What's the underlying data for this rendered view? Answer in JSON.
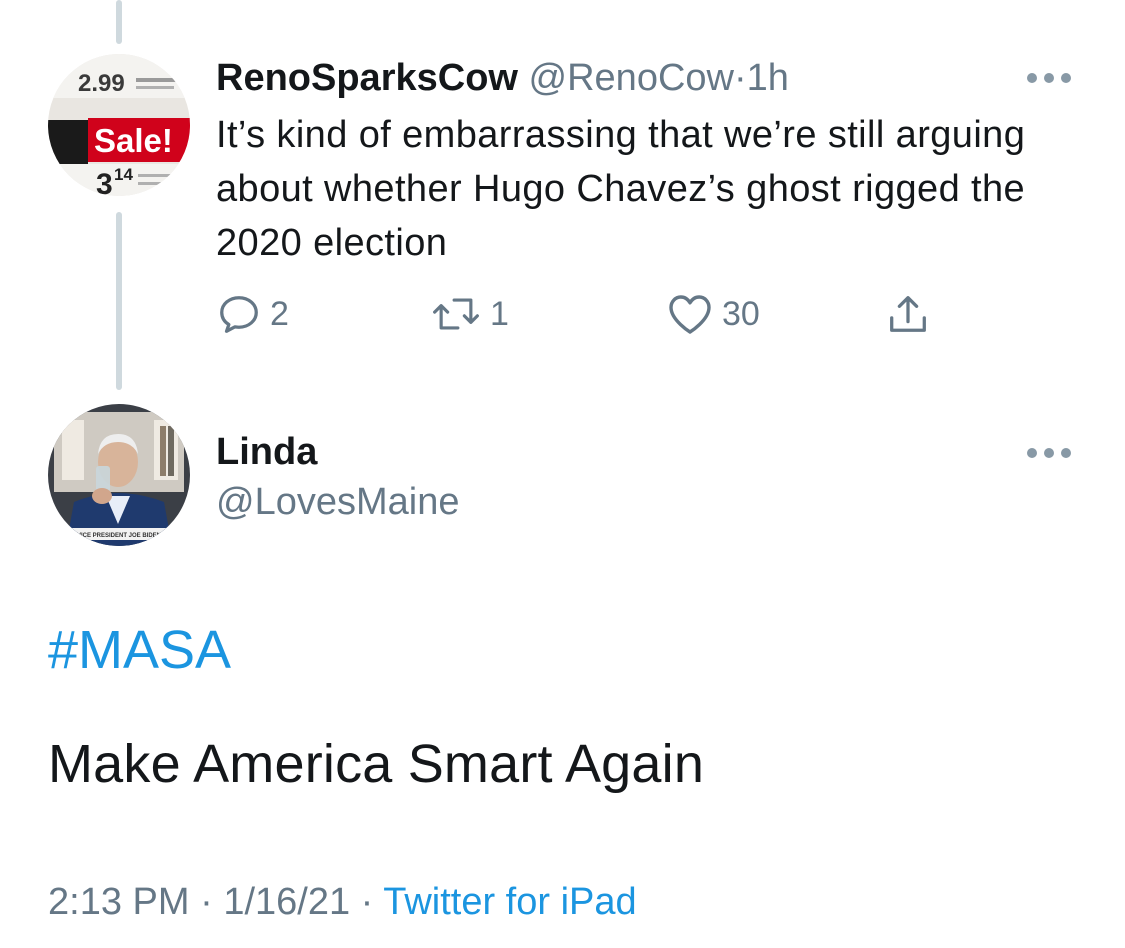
{
  "reply_tweet": {
    "display_name": "RenoSparksCow",
    "handle": "@RenoCow",
    "separator": "·",
    "time": "1h",
    "avatar": {
      "icon": "price-tag-avatar",
      "price_top": "2.99",
      "sale_label": "Sale!",
      "price_main": "3",
      "price_cents": "14",
      "sale_color": "#d0021b"
    },
    "text": "It’s kind of embarrassing that we’re still arguing about whether Hugo Chavez’s ghost rigged the 2020 election",
    "actions": {
      "reply_icon": "reply-icon",
      "reply_count": "2",
      "retweet_icon": "retweet-icon",
      "retweet_count": "1",
      "like_icon": "heart-icon",
      "like_count": "30",
      "share_icon": "share-icon"
    }
  },
  "main_tweet": {
    "display_name": "Linda",
    "handle": "@LovesMaine",
    "avatar": {
      "icon": "person-photo-avatar",
      "caption": "VICE PRESIDENT JOE BIDEN"
    },
    "hashtag": "#MASA",
    "text": "Make America Smart Again",
    "meta": {
      "time": "2:13 PM",
      "separator": "·",
      "date": "1/16/21",
      "source": "Twitter for iPad"
    }
  },
  "colors": {
    "link": "#1b95e0",
    "secondary_text": "#657786",
    "thread_line": "#cfd9de"
  }
}
